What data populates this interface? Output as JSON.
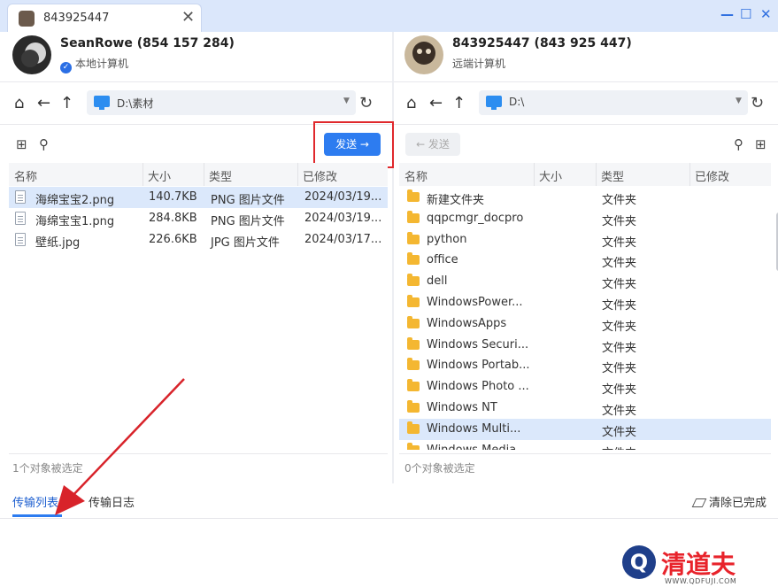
{
  "window": {
    "tab_title": "843925447",
    "tab_close": "✕",
    "controls": [
      "—",
      "☐",
      "✕"
    ]
  },
  "left": {
    "user_name": "SeanRowe (854 157 284)",
    "user_sub": "本地计算机",
    "path": "D:\\素材",
    "send_label": "发送 →",
    "columns": [
      "名称",
      "大小",
      "类型",
      "已修改"
    ],
    "files": [
      {
        "name": "海绵宝宝2.png",
        "size": "140.7KB",
        "type": "PNG 图片文件",
        "modified": "2024/03/19..."
      },
      {
        "name": "海绵宝宝1.png",
        "size": "284.8KB",
        "type": "PNG 图片文件",
        "modified": "2024/03/19..."
      },
      {
        "name": "壁纸.jpg",
        "size": "226.6KB",
        "type": "JPG 图片文件",
        "modified": "2024/03/17..."
      }
    ],
    "status": "1个对象被选定"
  },
  "right": {
    "user_name": "843925447 (843 925 447)",
    "user_sub": "远端计算机",
    "path": "D:\\",
    "send_label": "← 发送",
    "columns": [
      "名称",
      "大小",
      "类型",
      "已修改"
    ],
    "files": [
      {
        "name": "新建文件夹",
        "type": "文件夹"
      },
      {
        "name": "qqpcmgr_docpro",
        "type": "文件夹"
      },
      {
        "name": "python",
        "type": "文件夹"
      },
      {
        "name": "office",
        "type": "文件夹"
      },
      {
        "name": "dell",
        "type": "文件夹"
      },
      {
        "name": "WindowsPower...",
        "type": "文件夹"
      },
      {
        "name": "WindowsApps",
        "type": "文件夹"
      },
      {
        "name": "Windows Securi...",
        "type": "文件夹"
      },
      {
        "name": "Windows Portab...",
        "type": "文件夹"
      },
      {
        "name": "Windows Photo ...",
        "type": "文件夹"
      },
      {
        "name": "Windows NT",
        "type": "文件夹"
      },
      {
        "name": "Windows Multi...",
        "type": "文件夹"
      },
      {
        "name": "Windows Media",
        "type": "文件夹"
      }
    ],
    "status": "0个对象被选定"
  },
  "icons": {
    "home": "⌂",
    "back": "←",
    "up": "↑",
    "refresh": "↻",
    "caret": "▼",
    "new_folder": "⊞",
    "search": "⚲"
  },
  "bottom": {
    "tab_transfer_list": "传输列表",
    "tab_transfer_log": "传输日志",
    "clear_done": "清除已完成"
  },
  "watermark": {
    "letter": "Q",
    "text": "清道夫",
    "url": "WWW.QDFUJI.COM"
  },
  "colors": {
    "accent": "#2d7cf0",
    "highlight_box": "#e0282c",
    "arrow": "#d8232a",
    "selected_row": "#dbe8fb"
  }
}
